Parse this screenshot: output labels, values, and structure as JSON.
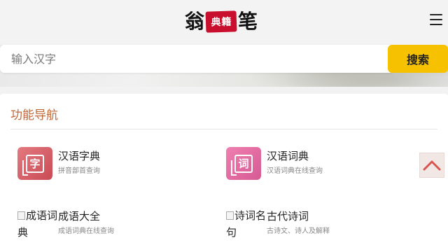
{
  "header": {
    "logo": {
      "left": "翁",
      "seal": [
        "典",
        "籍"
      ],
      "right": "笔"
    },
    "menu_icon": "hamburger-menu-icon"
  },
  "search": {
    "placeholder": "输入汉字",
    "button_label": "搜索"
  },
  "nav": {
    "title": "功能导航",
    "items": [
      {
        "name": "汉语字典",
        "desc": "拼音部首查询",
        "icon": "zi-character-icon",
        "glyph": "字",
        "color": "#d65a64"
      },
      {
        "name": "汉语词典",
        "desc": "汉语词典在线查询",
        "icon": "ci-word-icon",
        "glyph": "词",
        "color": "#de6aa0"
      },
      {
        "name": "成语大全",
        "desc": "成语词典在线查询",
        "icon": "broken-image-icon",
        "alt": "成语词典"
      },
      {
        "name": "古代诗词",
        "desc": "古诗文、诗人及解释",
        "icon": "broken-image-icon",
        "alt": "诗词名句"
      }
    ]
  },
  "back_to_top": {
    "icon": "chevron-up-icon",
    "color": "#d9534f"
  },
  "colors": {
    "accent": "#f6c200",
    "title": "#c0683a"
  }
}
